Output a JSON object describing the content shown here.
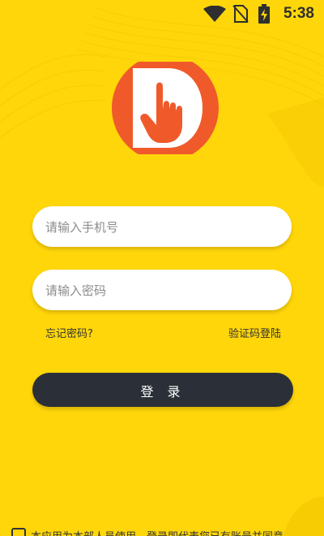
{
  "status_bar": {
    "time": "5:38",
    "icons": [
      "wifi-icon",
      "no-sim-icon",
      "battery-charging-icon"
    ]
  },
  "logo": {
    "icon": "hand-pointer-logo",
    "colors": {
      "circle": "#F05A2B",
      "shape": "#FFFFFF"
    }
  },
  "form": {
    "phone_placeholder": "请输入手机号",
    "password_placeholder": "请输入密码",
    "forgot_label": "忘记密码?",
    "code_login_label": "验证码登陆",
    "login_label": "登 录"
  },
  "agreement": {
    "text": "本应用为本部人员使用，登录即代表您已有账号并同意"
  },
  "colors": {
    "background": "#FFD60A",
    "button": "#2B3038",
    "input": "#FFFFFF"
  }
}
